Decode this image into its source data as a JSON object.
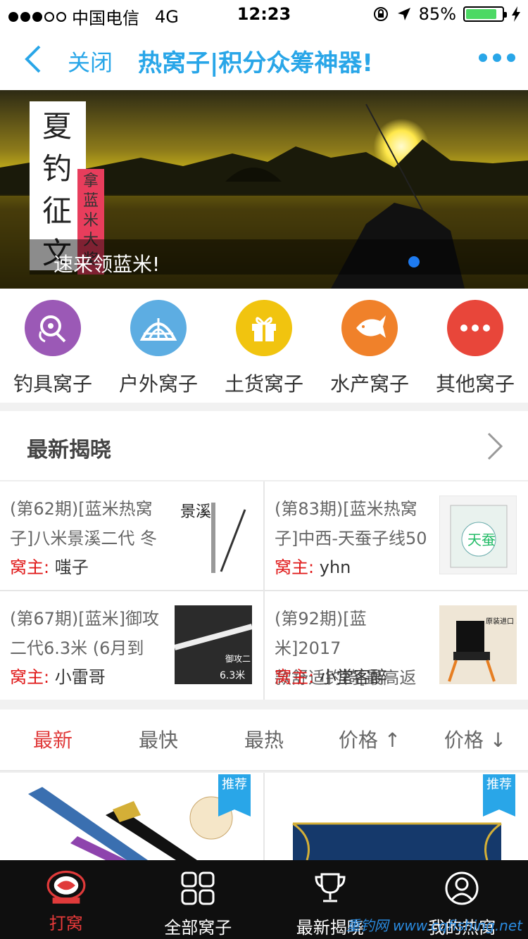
{
  "status": {
    "carrier": "中国电信",
    "network": "4G",
    "time": "12:23",
    "battery": "85%",
    "battery_level": 0.85
  },
  "nav": {
    "close": "关闭",
    "title": "热窝子|积分众筹神器!"
  },
  "banner": {
    "poster_title": [
      "夏",
      "钓",
      "征",
      "文"
    ],
    "poster_tag": "拿蓝米大奖",
    "caption": "速来领蓝米!"
  },
  "categories": [
    {
      "label": "钓具窝子",
      "color": "#9b59b6",
      "icon": "fishing-reel-icon"
    },
    {
      "label": "户外窝子",
      "color": "#5dade2",
      "icon": "tent-icon"
    },
    {
      "label": "土货窝子",
      "color": "#f1c40f",
      "icon": "gift-icon"
    },
    {
      "label": "水产窝子",
      "color": "#f0812a",
      "icon": "fish-icon"
    },
    {
      "label": "其他窝子",
      "color": "#e8463a",
      "icon": "more-icon"
    }
  ],
  "reveal": {
    "title": "最新揭晓",
    "owner_label": "窝主:",
    "items": [
      {
        "line1": "(第62期)[蓝米热窝",
        "line2": "子]八米景溪二代 冬",
        "owner": "嗤子"
      },
      {
        "line1": "(第83期)[蓝米热窝",
        "line2": "子]中西-天蚕子线50",
        "owner": "yhn"
      },
      {
        "line1": "(第67期)[蓝米]御攻",
        "line2": "二代6.3米 (6月到",
        "owner": "小雷哥"
      },
      {
        "line1": "(第92期)[蓝米]2017",
        "line2": "款舒适钓椅[最高返",
        "owner": "小堂客醉"
      }
    ],
    "thumb_texts": {
      "rod_brand": "景溪",
      "line_brand": "天蚕",
      "rod2_text": "御攻二",
      "rod2_size": "6.3米",
      "chair_badge": "原装进口 398"
    }
  },
  "sort": {
    "newest": "最新",
    "fastest": "最快",
    "hottest": "最热",
    "price_up": "价格 ↑",
    "price_down": "价格 ↓"
  },
  "products": {
    "tag": "推荐"
  },
  "tabs": [
    {
      "label": "打窝"
    },
    {
      "label": "全部窝子"
    },
    {
      "label": "最新揭晓"
    },
    {
      "label": "我的热窝"
    }
  ],
  "watermark": "重钓网 www.cqfishing.net"
}
